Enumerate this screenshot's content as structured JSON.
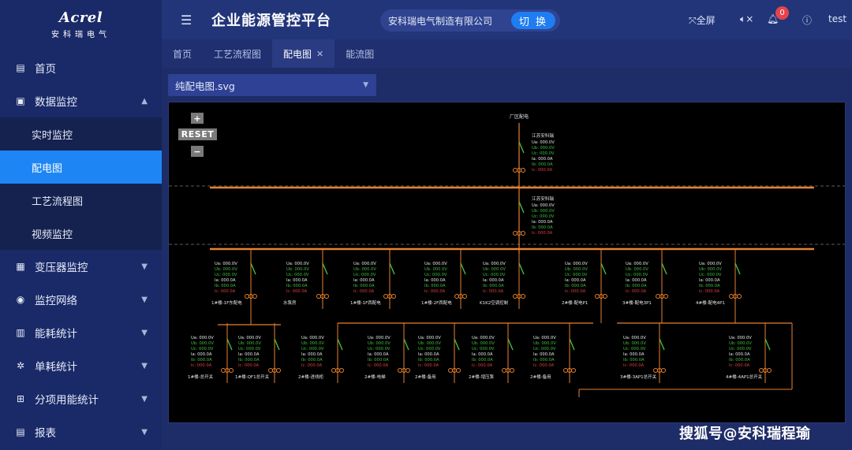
{
  "logo": {
    "brand": "Acrel",
    "sub": "安科瑞电气"
  },
  "sidebar": {
    "items": [
      {
        "label": "首页",
        "icon": "home-icon"
      },
      {
        "label": "数据监控",
        "icon": "monitor-icon",
        "expanded": true,
        "children": [
          {
            "label": "实时监控"
          },
          {
            "label": "配电图",
            "active": true
          },
          {
            "label": "工艺流程图"
          },
          {
            "label": "视频监控"
          }
        ]
      },
      {
        "label": "变压器监控",
        "icon": "calendar-icon"
      },
      {
        "label": "监控网络",
        "icon": "network-icon"
      },
      {
        "label": "能耗统计",
        "icon": "bar-chart-icon"
      },
      {
        "label": "单耗统计",
        "icon": "nodes-icon"
      },
      {
        "label": "分项用能统计",
        "icon": "grid-icon"
      },
      {
        "label": "报表",
        "icon": "document-icon"
      }
    ]
  },
  "header": {
    "title": "企业能源管控平台",
    "org": "安科瑞电气制造有限公司",
    "switch_label": "切 换",
    "fullscreen_label": "全屏",
    "notification_count": "0",
    "user": "test"
  },
  "tabs": [
    {
      "label": "首页"
    },
    {
      "label": "工艺流程图"
    },
    {
      "label": "配电图",
      "active": true,
      "closable": true
    },
    {
      "label": "能流图"
    }
  ],
  "file_select": {
    "value": "纯配电图.svg"
  },
  "diagram": {
    "zoom_in": "+",
    "reset": "RESET",
    "zoom_out": "−",
    "title": "厂区配电",
    "source_label": "江苏安科瑞",
    "readings": [
      "Ua: 000.0V",
      "Ub: 000.0V",
      "Uc: 000.0V",
      "Ia: 000.0A",
      "Ib: 000.0A",
      "Ic: 000.0A"
    ],
    "upper_feeders": [
      "1#楼-1F东配电",
      "水泵房",
      "1#楼-1F西配电",
      "1#楼-2F西配电",
      "K1K2空调控制",
      "2#楼-配电P1",
      "3#楼-配电3P1",
      "4#楼-配电4P1"
    ],
    "lower_feeders": [
      "1#楼-总开关",
      "1#楼-QF1总开关",
      "2#楼-进线柜",
      "2#楼-电梯",
      "2#楼-备用",
      "2#楼-增压泵",
      "2#楼-备用",
      "3#楼-3AP1总开关",
      "4#楼-4AP1总开关"
    ]
  },
  "watermark": "搜狐号@安科瑞程瑜"
}
